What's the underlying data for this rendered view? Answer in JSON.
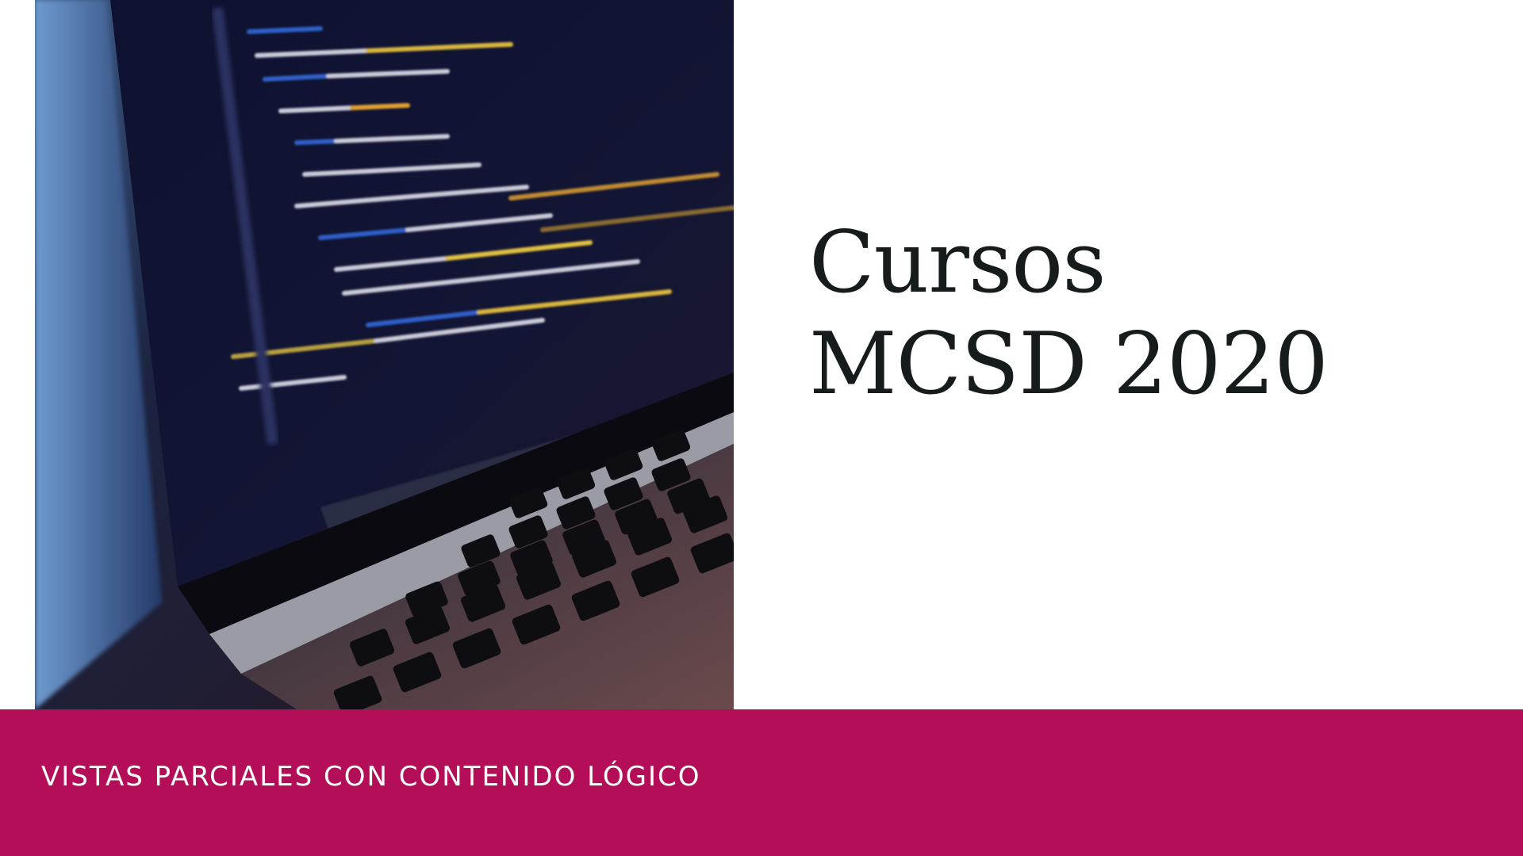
{
  "title": {
    "line1": "Cursos",
    "line2": "MCSD 2020"
  },
  "subtitle": "VISTAS PARCIALES CON CONTENIDO LÓGICO",
  "colors": {
    "accent_band": "#b30e57",
    "title_text": "#161c1c",
    "subtitle_text": "#ffffff",
    "background": "#ffffff"
  },
  "photo": {
    "subject": "laptop-code-screen"
  }
}
